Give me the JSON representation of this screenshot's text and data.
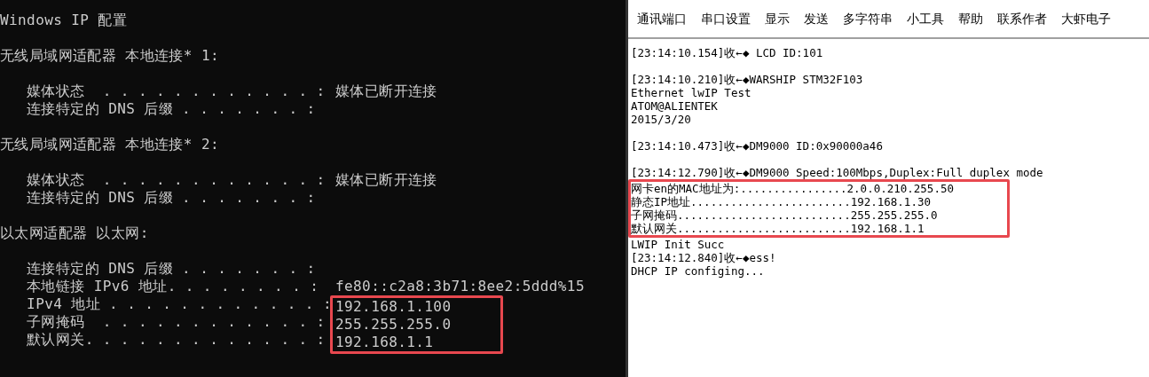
{
  "terminal": {
    "blocks": [
      [
        {
          "text": "Windows IP 配置"
        }
      ],
      [
        {
          "text": "无线局域网适配器 本地连接* 1:"
        }
      ],
      [
        {
          "text": "   媒体状态  . . . . . . . . . . . . :",
          "value": "媒体已断开连接",
          "highlighted": false
        },
        {
          "text": "   连接特定的 DNS 后缀 . . . . . . . :",
          "highlighted": false
        }
      ],
      [
        {
          "text": "无线局域网适配器 本地连接* 2:"
        }
      ],
      [
        {
          "text": "   媒体状态  . . . . . . . . . . . . :",
          "value": "媒体已断开连接",
          "highlighted": false
        },
        {
          "text": "   连接特定的 DNS 后缀 . . . . . . . :",
          "highlighted": false
        }
      ],
      [
        {
          "text": "以太网适配器 以太网:"
        }
      ],
      [
        {
          "text": "   连接特定的 DNS 后缀 . . . . . . . :",
          "highlighted": false
        },
        {
          "text": "   本地链接 IPv6 地址. . . . . . . . :",
          "value": "fe80::c2a8:3b71:8ee2:5ddd%15",
          "highlighted": false
        },
        {
          "text": "   IPv4 地址 . . . . . . . . . . . . :",
          "value": "192.168.1.100",
          "highlighted": true
        },
        {
          "text": "   子网掩码  . . . . . . . . . . . . :",
          "value": "255.255.255.0",
          "highlighted": true
        },
        {
          "text": "   默认网关. . . . . . . . . . . . . :",
          "value": "192.168.1.1",
          "highlighted": true
        }
      ]
    ]
  },
  "serial_tool": {
    "menu": [
      "通讯端口",
      "串口设置",
      "显示",
      "发送",
      "多字符串",
      "小工具",
      "帮助",
      "联系作者",
      "大虾电子"
    ],
    "blocks": [
      [
        {
          "text": "[23:14:10.154]收←◆ LCD ID:101",
          "highlighted": false
        }
      ],
      [
        {
          "text": "[23:14:10.210]收←◆WARSHIP STM32F103",
          "highlighted": false
        },
        {
          "text": "Ethernet lwIP Test",
          "highlighted": false
        },
        {
          "text": "ATOM@ALIENTEK",
          "highlighted": false
        },
        {
          "text": "2015/3/20",
          "highlighted": false
        }
      ],
      [
        {
          "text": "[23:14:10.473]收←◆DM9000 ID:0x90000a46",
          "highlighted": false
        }
      ],
      [
        {
          "text": "[23:14:12.790]收←◆DM9000 Speed:100Mbps,Duplex:Full duplex mode",
          "highlighted": false
        },
        {
          "text": "网卡en的MAC地址为:................2.0.0.210.255.50",
          "highlighted": true
        },
        {
          "text": "静态IP地址........................192.168.1.30",
          "highlighted": true
        },
        {
          "text": "子网掩码..........................255.255.255.0",
          "highlighted": true
        },
        {
          "text": "默认网关..........................192.168.1.1",
          "highlighted": true
        },
        {
          "text": "LWIP Init Succ",
          "highlighted": false
        },
        {
          "text": "[23:14:12.840]收←◆ess!",
          "highlighted": false
        },
        {
          "text": "DHCP IP configing...",
          "highlighted": false
        }
      ]
    ]
  }
}
